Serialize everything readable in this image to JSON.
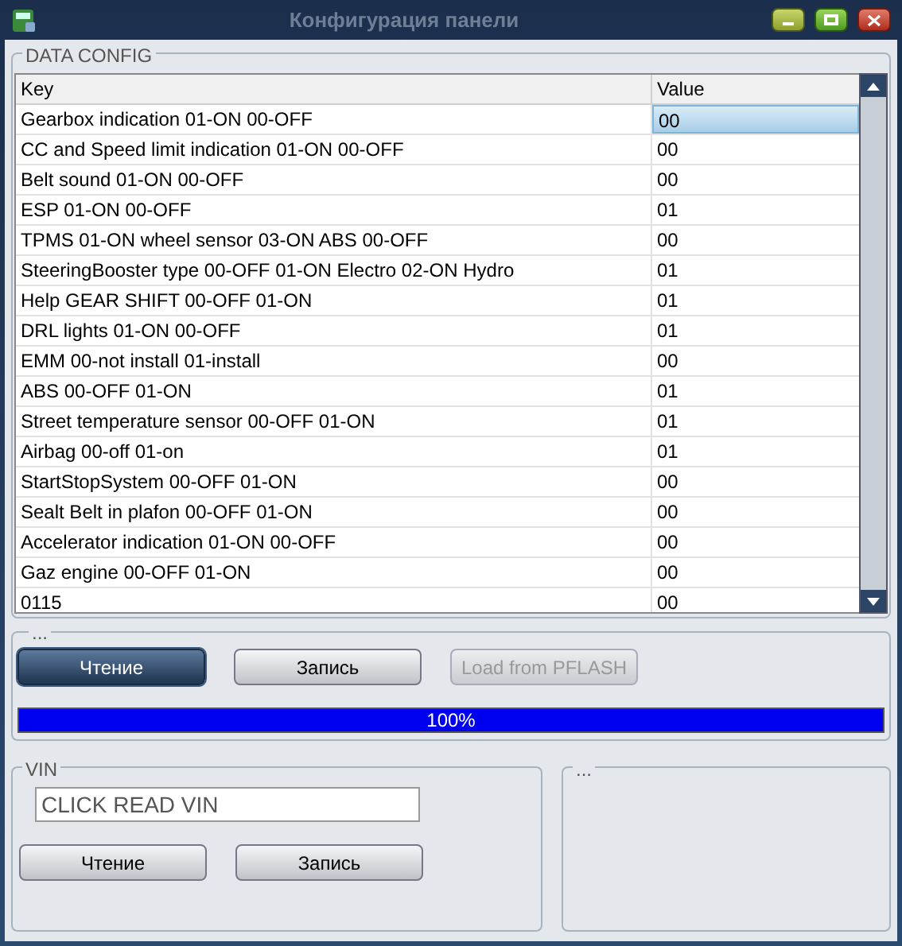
{
  "window": {
    "title": "Конфигурация панели"
  },
  "data_config": {
    "title": "DATA CONFIG",
    "columns": [
      "Key",
      "Value"
    ],
    "rows": [
      {
        "key": "Gearbox indication 01-ON 00-OFF",
        "value": "00",
        "selected": true
      },
      {
        "key": "CC and Speed limit indication 01-ON 00-OFF",
        "value": "00",
        "selected": false
      },
      {
        "key": "Belt sound 01-ON 00-OFF",
        "value": "00",
        "selected": false
      },
      {
        "key": "ESP 01-ON 00-OFF",
        "value": "01",
        "selected": false
      },
      {
        "key": "TPMS 01-ON wheel sensor 03-ON ABS 00-OFF",
        "value": "00",
        "selected": false
      },
      {
        "key": "SteeringBooster type 00-OFF 01-ON Electro 02-ON Hydro",
        "value": "01",
        "selected": false
      },
      {
        "key": "Help GEAR SHIFT 00-OFF 01-ON",
        "value": "01",
        "selected": false
      },
      {
        "key": "DRL lights 01-ON 00-OFF",
        "value": "01",
        "selected": false
      },
      {
        "key": "EMM 00-not install 01-install",
        "value": "00",
        "selected": false
      },
      {
        "key": "ABS 00-OFF 01-ON",
        "value": "01",
        "selected": false
      },
      {
        "key": "Street temperature sensor 00-OFF 01-ON",
        "value": "01",
        "selected": false
      },
      {
        "key": "Airbag 00-off 01-on",
        "value": "01",
        "selected": false
      },
      {
        "key": "StartStopSystem 00-OFF 01-ON",
        "value": "00",
        "selected": false
      },
      {
        "key": "Sealt Belt in plafon 00-OFF 01-ON",
        "value": "00",
        "selected": false
      },
      {
        "key": "Accelerator indication 01-ON 00-OFF",
        "value": "00",
        "selected": false
      },
      {
        "key": "Gaz engine 00-OFF 01-ON",
        "value": "00",
        "selected": false
      },
      {
        "key": "0115",
        "value": "00",
        "selected": false
      }
    ]
  },
  "actions": {
    "title": "...",
    "buttons": [
      {
        "label": "Чтение",
        "selected": true,
        "disabled": false
      },
      {
        "label": "Запись",
        "selected": false,
        "disabled": false
      },
      {
        "label": "Load from PFLASH",
        "selected": false,
        "disabled": true
      }
    ],
    "progress": {
      "level": 1.0,
      "reading": "100%"
    }
  },
  "vin": {
    "title": "VIN",
    "value": "CLICK READ VIN",
    "buttons": [
      {
        "label": "Чтение"
      },
      {
        "label": "Запись"
      }
    ]
  },
  "right_panel": {
    "title": "..."
  }
}
